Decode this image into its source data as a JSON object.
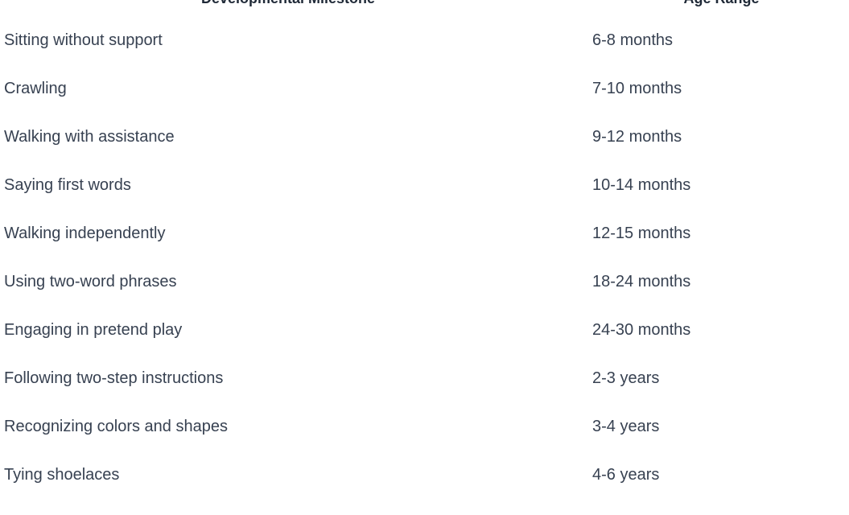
{
  "table": {
    "headers": {
      "milestone": "Developmental Milestone",
      "age_range": "Age Range"
    },
    "rows": [
      {
        "milestone": "Sitting without support",
        "age_range": "6-8 months"
      },
      {
        "milestone": "Crawling",
        "age_range": "7-10 months"
      },
      {
        "milestone": "Walking with assistance",
        "age_range": "9-12 months"
      },
      {
        "milestone": "Saying first words",
        "age_range": "10-14 months"
      },
      {
        "milestone": "Walking independently",
        "age_range": "12-15 months"
      },
      {
        "milestone": "Using two-word phrases",
        "age_range": "18-24 months"
      },
      {
        "milestone": "Engaging in pretend play",
        "age_range": "24-30 months"
      },
      {
        "milestone": "Following two-step instructions",
        "age_range": "2-3 years"
      },
      {
        "milestone": "Recognizing colors and shapes",
        "age_range": "3-4 years"
      },
      {
        "milestone": "Tying shoelaces",
        "age_range": "4-6 years"
      }
    ]
  },
  "colors": {
    "header_text": "#1f2937",
    "body_text": "#374151",
    "background": "#ffffff"
  }
}
